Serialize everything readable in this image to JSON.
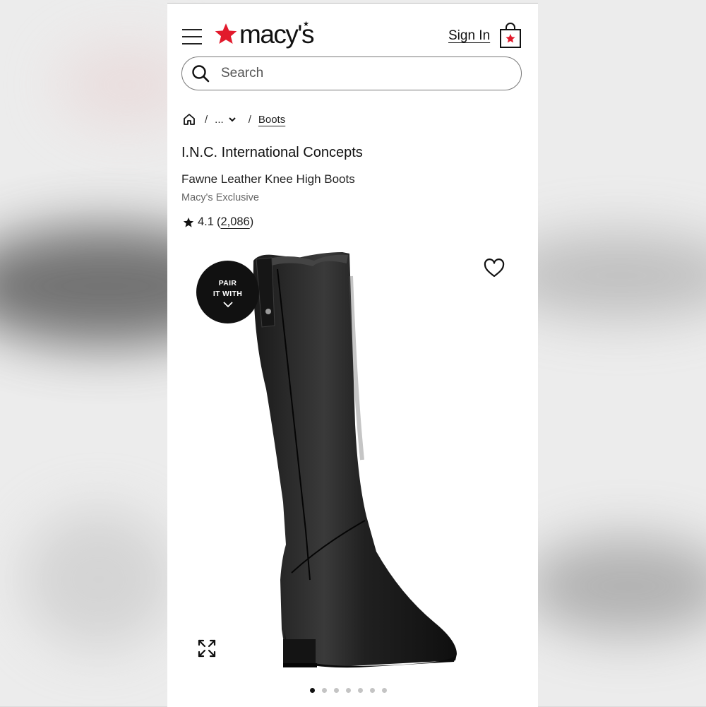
{
  "header": {
    "logo_text": "macy's",
    "brand_color": "#e21a2c",
    "signin_label": "Sign In"
  },
  "search": {
    "placeholder": "Search"
  },
  "breadcrumb": {
    "more_label": "...",
    "current_label": "Boots"
  },
  "product": {
    "brand": "I.N.C. International Concepts",
    "name": "Fawne Leather Knee High Boots",
    "exclusive_label": "Macy's Exclusive",
    "rating": "4.1",
    "review_count": "2,086",
    "image_color": "black"
  },
  "pair_badge": {
    "line1": "PAIR",
    "line2": "IT WITH"
  },
  "carousel": {
    "total": 7,
    "active_index": 0
  }
}
